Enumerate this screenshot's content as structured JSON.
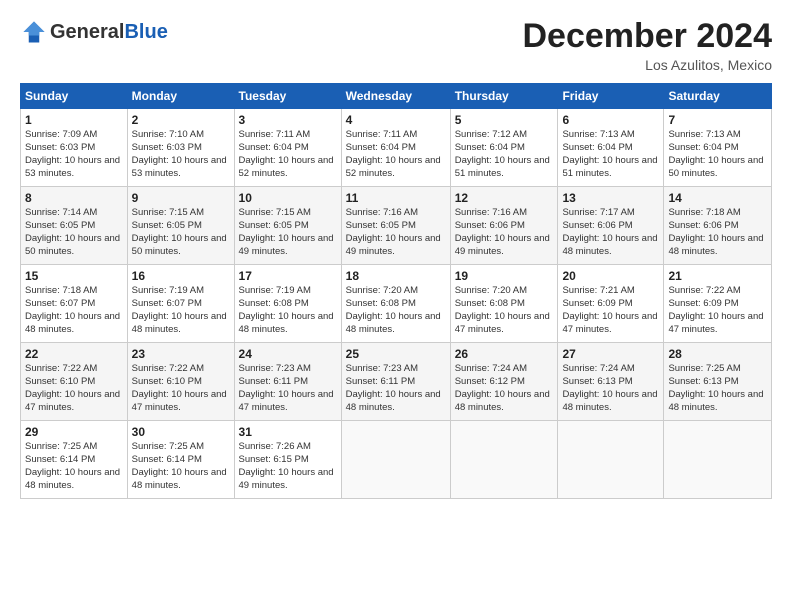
{
  "logo": {
    "general": "General",
    "blue": "Blue"
  },
  "header": {
    "month": "December 2024",
    "location": "Los Azulitos, Mexico"
  },
  "weekdays": [
    "Sunday",
    "Monday",
    "Tuesday",
    "Wednesday",
    "Thursday",
    "Friday",
    "Saturday"
  ],
  "weeks": [
    [
      {
        "day": "1",
        "sunrise": "7:09 AM",
        "sunset": "6:03 PM",
        "daylight": "10 hours and 53 minutes."
      },
      {
        "day": "2",
        "sunrise": "7:10 AM",
        "sunset": "6:03 PM",
        "daylight": "10 hours and 53 minutes."
      },
      {
        "day": "3",
        "sunrise": "7:11 AM",
        "sunset": "6:04 PM",
        "daylight": "10 hours and 52 minutes."
      },
      {
        "day": "4",
        "sunrise": "7:11 AM",
        "sunset": "6:04 PM",
        "daylight": "10 hours and 52 minutes."
      },
      {
        "day": "5",
        "sunrise": "7:12 AM",
        "sunset": "6:04 PM",
        "daylight": "10 hours and 51 minutes."
      },
      {
        "day": "6",
        "sunrise": "7:13 AM",
        "sunset": "6:04 PM",
        "daylight": "10 hours and 51 minutes."
      },
      {
        "day": "7",
        "sunrise": "7:13 AM",
        "sunset": "6:04 PM",
        "daylight": "10 hours and 50 minutes."
      }
    ],
    [
      {
        "day": "8",
        "sunrise": "7:14 AM",
        "sunset": "6:05 PM",
        "daylight": "10 hours and 50 minutes."
      },
      {
        "day": "9",
        "sunrise": "7:15 AM",
        "sunset": "6:05 PM",
        "daylight": "10 hours and 50 minutes."
      },
      {
        "day": "10",
        "sunrise": "7:15 AM",
        "sunset": "6:05 PM",
        "daylight": "10 hours and 49 minutes."
      },
      {
        "day": "11",
        "sunrise": "7:16 AM",
        "sunset": "6:05 PM",
        "daylight": "10 hours and 49 minutes."
      },
      {
        "day": "12",
        "sunrise": "7:16 AM",
        "sunset": "6:06 PM",
        "daylight": "10 hours and 49 minutes."
      },
      {
        "day": "13",
        "sunrise": "7:17 AM",
        "sunset": "6:06 PM",
        "daylight": "10 hours and 48 minutes."
      },
      {
        "day": "14",
        "sunrise": "7:18 AM",
        "sunset": "6:06 PM",
        "daylight": "10 hours and 48 minutes."
      }
    ],
    [
      {
        "day": "15",
        "sunrise": "7:18 AM",
        "sunset": "6:07 PM",
        "daylight": "10 hours and 48 minutes."
      },
      {
        "day": "16",
        "sunrise": "7:19 AM",
        "sunset": "6:07 PM",
        "daylight": "10 hours and 48 minutes."
      },
      {
        "day": "17",
        "sunrise": "7:19 AM",
        "sunset": "6:08 PM",
        "daylight": "10 hours and 48 minutes."
      },
      {
        "day": "18",
        "sunrise": "7:20 AM",
        "sunset": "6:08 PM",
        "daylight": "10 hours and 48 minutes."
      },
      {
        "day": "19",
        "sunrise": "7:20 AM",
        "sunset": "6:08 PM",
        "daylight": "10 hours and 47 minutes."
      },
      {
        "day": "20",
        "sunrise": "7:21 AM",
        "sunset": "6:09 PM",
        "daylight": "10 hours and 47 minutes."
      },
      {
        "day": "21",
        "sunrise": "7:22 AM",
        "sunset": "6:09 PM",
        "daylight": "10 hours and 47 minutes."
      }
    ],
    [
      {
        "day": "22",
        "sunrise": "7:22 AM",
        "sunset": "6:10 PM",
        "daylight": "10 hours and 47 minutes."
      },
      {
        "day": "23",
        "sunrise": "7:22 AM",
        "sunset": "6:10 PM",
        "daylight": "10 hours and 47 minutes."
      },
      {
        "day": "24",
        "sunrise": "7:23 AM",
        "sunset": "6:11 PM",
        "daylight": "10 hours and 47 minutes."
      },
      {
        "day": "25",
        "sunrise": "7:23 AM",
        "sunset": "6:11 PM",
        "daylight": "10 hours and 48 minutes."
      },
      {
        "day": "26",
        "sunrise": "7:24 AM",
        "sunset": "6:12 PM",
        "daylight": "10 hours and 48 minutes."
      },
      {
        "day": "27",
        "sunrise": "7:24 AM",
        "sunset": "6:13 PM",
        "daylight": "10 hours and 48 minutes."
      },
      {
        "day": "28",
        "sunrise": "7:25 AM",
        "sunset": "6:13 PM",
        "daylight": "10 hours and 48 minutes."
      }
    ],
    [
      {
        "day": "29",
        "sunrise": "7:25 AM",
        "sunset": "6:14 PM",
        "daylight": "10 hours and 48 minutes."
      },
      {
        "day": "30",
        "sunrise": "7:25 AM",
        "sunset": "6:14 PM",
        "daylight": "10 hours and 48 minutes."
      },
      {
        "day": "31",
        "sunrise": "7:26 AM",
        "sunset": "6:15 PM",
        "daylight": "10 hours and 49 minutes."
      },
      null,
      null,
      null,
      null
    ]
  ],
  "labels": {
    "sunrise": "Sunrise:",
    "sunset": "Sunset:",
    "daylight": "Daylight:"
  }
}
